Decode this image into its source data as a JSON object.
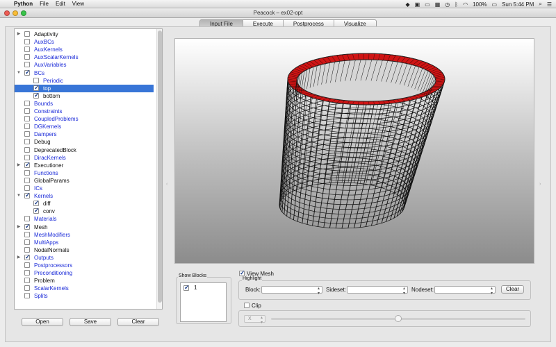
{
  "menubar": {
    "app_name": "Python",
    "menus": [
      "File",
      "Edit",
      "View"
    ],
    "battery": "100%",
    "clock": "Sun 5:44 PM"
  },
  "window": {
    "title": "Peacock – ex02-opt",
    "tabs": [
      {
        "label": "Input File",
        "active": true
      },
      {
        "label": "Execute",
        "active": false
      },
      {
        "label": "Postprocess",
        "active": false
      },
      {
        "label": "Visualize",
        "active": false
      }
    ]
  },
  "tree": {
    "items": [
      {
        "label": "Adaptivity",
        "level": 0,
        "expandable": true,
        "checked": false,
        "blue": false,
        "selected": false
      },
      {
        "label": "AuxBCs",
        "level": 0,
        "expandable": false,
        "checked": false,
        "blue": true,
        "selected": false
      },
      {
        "label": "AuxKernels",
        "level": 0,
        "expandable": false,
        "checked": false,
        "blue": true,
        "selected": false
      },
      {
        "label": "AuxScalarKernels",
        "level": 0,
        "expandable": false,
        "checked": false,
        "blue": true,
        "selected": false
      },
      {
        "label": "AuxVariables",
        "level": 0,
        "expandable": false,
        "checked": false,
        "blue": true,
        "selected": false
      },
      {
        "label": "BCs",
        "level": 0,
        "expandable": true,
        "expanded": true,
        "checked": true,
        "blue": true,
        "selected": false
      },
      {
        "label": "Periodic",
        "level": 1,
        "expandable": false,
        "checked": false,
        "blue": true,
        "selected": false
      },
      {
        "label": "top",
        "level": 1,
        "expandable": false,
        "checked": true,
        "blue": false,
        "selected": true
      },
      {
        "label": "bottom",
        "level": 1,
        "expandable": false,
        "checked": true,
        "blue": false,
        "selected": false
      },
      {
        "label": "Bounds",
        "level": 0,
        "expandable": false,
        "checked": false,
        "blue": true,
        "selected": false
      },
      {
        "label": "Constraints",
        "level": 0,
        "expandable": false,
        "checked": false,
        "blue": true,
        "selected": false
      },
      {
        "label": "CoupledProblems",
        "level": 0,
        "expandable": false,
        "checked": false,
        "blue": true,
        "selected": false
      },
      {
        "label": "DGKernels",
        "level": 0,
        "expandable": false,
        "checked": false,
        "blue": true,
        "selected": false
      },
      {
        "label": "Dampers",
        "level": 0,
        "expandable": false,
        "checked": false,
        "blue": true,
        "selected": false
      },
      {
        "label": "Debug",
        "level": 0,
        "expandable": false,
        "checked": false,
        "blue": false,
        "selected": false
      },
      {
        "label": "DeprecatedBlock",
        "level": 0,
        "expandable": false,
        "checked": false,
        "blue": false,
        "selected": false
      },
      {
        "label": "DiracKernels",
        "level": 0,
        "expandable": false,
        "checked": false,
        "blue": true,
        "selected": false
      },
      {
        "label": "Executioner",
        "level": 0,
        "expandable": true,
        "checked": true,
        "blue": false,
        "selected": false
      },
      {
        "label": "Functions",
        "level": 0,
        "expandable": false,
        "checked": false,
        "blue": true,
        "selected": false
      },
      {
        "label": "GlobalParams",
        "level": 0,
        "expandable": false,
        "checked": false,
        "blue": false,
        "selected": false
      },
      {
        "label": "ICs",
        "level": 0,
        "expandable": false,
        "checked": false,
        "blue": true,
        "selected": false
      },
      {
        "label": "Kernels",
        "level": 0,
        "expandable": true,
        "expanded": true,
        "checked": true,
        "blue": true,
        "selected": false
      },
      {
        "label": "diff",
        "level": 1,
        "expandable": false,
        "checked": true,
        "blue": false,
        "selected": false
      },
      {
        "label": "conv",
        "level": 1,
        "expandable": false,
        "checked": true,
        "blue": false,
        "selected": false
      },
      {
        "label": "Materials",
        "level": 0,
        "expandable": false,
        "checked": false,
        "blue": true,
        "selected": false
      },
      {
        "label": "Mesh",
        "level": 0,
        "expandable": true,
        "checked": true,
        "blue": false,
        "selected": false
      },
      {
        "label": "MeshModifiers",
        "level": 0,
        "expandable": false,
        "checked": false,
        "blue": true,
        "selected": false
      },
      {
        "label": "MultiApps",
        "level": 0,
        "expandable": false,
        "checked": false,
        "blue": true,
        "selected": false
      },
      {
        "label": "NodalNormals",
        "level": 0,
        "expandable": false,
        "checked": false,
        "blue": false,
        "selected": false
      },
      {
        "label": "Outputs",
        "level": 0,
        "expandable": true,
        "checked": true,
        "blue": true,
        "selected": false
      },
      {
        "label": "Postprocessors",
        "level": 0,
        "expandable": false,
        "checked": false,
        "blue": true,
        "selected": false
      },
      {
        "label": "Preconditioning",
        "level": 0,
        "expandable": false,
        "checked": false,
        "blue": true,
        "selected": false
      },
      {
        "label": "Problem",
        "level": 0,
        "expandable": false,
        "checked": false,
        "blue": false,
        "selected": false
      },
      {
        "label": "ScalarKernels",
        "level": 0,
        "expandable": false,
        "checked": false,
        "blue": true,
        "selected": false
      },
      {
        "label": "Splits",
        "level": 0,
        "expandable": false,
        "checked": false,
        "blue": true,
        "selected": false
      }
    ]
  },
  "buttons": {
    "open": "Open",
    "save": "Save",
    "clear": "Clear",
    "highlight_clear": "Clear"
  },
  "controls": {
    "show_blocks_title": "Show Blocks",
    "block_list": [
      {
        "label": "1",
        "checked": true
      }
    ],
    "view_mesh_label": "View Mesh",
    "view_mesh_checked": true,
    "highlight_title": "Highlight",
    "block_label": "Block:",
    "sideset_label": "Sideset:",
    "nodeset_label": "Nodeset:",
    "clip_label": "Clip",
    "clip_checked": false,
    "clip_axis": "X",
    "clip_slider_fraction": 0.5
  },
  "colors": {
    "selection": "#3875d7",
    "link_blue": "#1a2ad8",
    "mesh_rim": "#d01515"
  },
  "icons": [
    "apple-icon",
    "wifi-icon",
    "battery-icon",
    "bluetooth-icon",
    "volume-icon",
    "spotlight-icon",
    "list-icon",
    "time-machine-icon"
  ]
}
